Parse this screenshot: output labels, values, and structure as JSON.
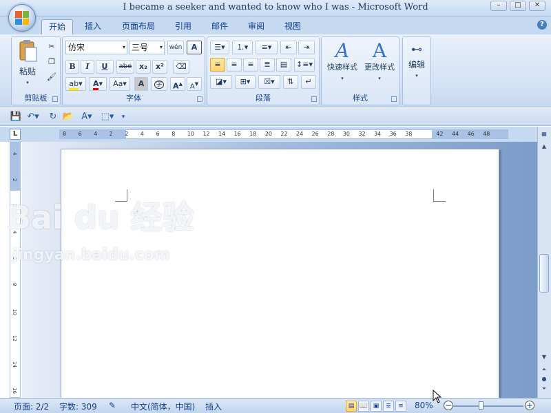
{
  "window": {
    "title": "I became a seeker and wanted to know who I was - Microsoft Word",
    "min": "–",
    "max": "□",
    "close": "✕",
    "help": "?"
  },
  "tabs": [
    "开始",
    "插入",
    "页面布局",
    "引用",
    "邮件",
    "审阅",
    "视图"
  ],
  "ribbon": {
    "clipboard": {
      "label": "剪贴板",
      "paste": "粘贴"
    },
    "font": {
      "label": "字体",
      "family": "仿宋",
      "size": "三号",
      "bold": "B",
      "italic": "I",
      "underline": "U",
      "strike": "abe",
      "sub": "x₂",
      "sup": "x²",
      "grow": "A",
      "shrink": "A",
      "case": "Aa",
      "phonetic": "wén",
      "border_char": "A",
      "shade_char": "A",
      "circle_char": "字"
    },
    "paragraph": {
      "label": "段落"
    },
    "styles": {
      "label": "样式",
      "quick": "快速样式",
      "change": "更改样式"
    },
    "editing": {
      "label": "编辑"
    }
  },
  "ruler": {
    "h_ticks": [
      "8",
      "6",
      "4",
      "2",
      "2",
      "4",
      "6",
      "8",
      "10",
      "12",
      "14",
      "16",
      "18",
      "20",
      "22",
      "24",
      "26",
      "28",
      "30",
      "32",
      "34",
      "36",
      "38",
      "42",
      "44",
      "46",
      "48"
    ],
    "v_ticks": [
      "4",
      "2",
      "2",
      "4",
      "6",
      "8",
      "10",
      "12",
      "14",
      "16"
    ],
    "tab_selector": "L"
  },
  "document": {
    "para_mark": "↵"
  },
  "status": {
    "page": "页面: 2/2",
    "words": "字数: 309",
    "language": "中文(简体，中国)",
    "mode": "插入",
    "zoom": "80%",
    "zoom_out": "−",
    "zoom_in": "+"
  },
  "watermark": {
    "logo": "Bai du 经验",
    "url": "jingyan.baidu.com"
  },
  "colors": {
    "accent": "#15428b",
    "ribbon_bg": "#dae6f6",
    "workspace": "#a3bbde"
  }
}
